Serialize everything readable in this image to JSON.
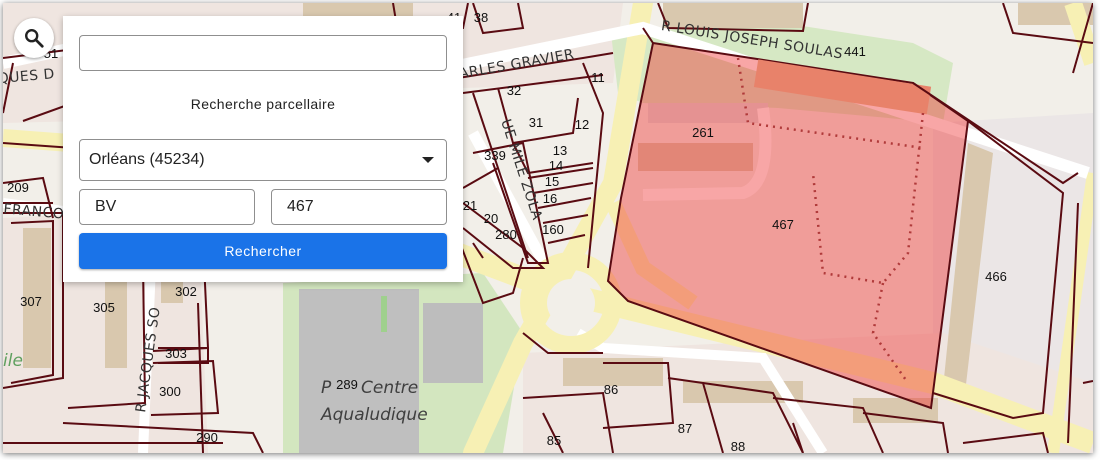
{
  "search_panel": {
    "free_search_value": "",
    "title": "Recherche parcellaire",
    "commune_value": "Orléans (45234)",
    "section_value": "BV",
    "numero_value": "467",
    "submit_label": "Rechercher",
    "toggle_icon": "search-icon",
    "dropdown_icon": "caret-down-icon"
  },
  "map": {
    "parcel_numbers": [
      "38",
      "41",
      "51",
      "11",
      "32",
      "31",
      "12",
      "339",
      "13",
      "14",
      "15",
      "16",
      "21",
      "20",
      "280",
      "160",
      "209",
      "307",
      "305",
      "302",
      "303",
      "300",
      "290",
      "261",
      "441",
      "467",
      "466",
      "289",
      "86",
      "87",
      "88",
      "85"
    ],
    "street_labels": [
      "QUES D",
      "ARLES GRAVIER",
      "R LOUIS JOSEPH SOULAS",
      "FRANCO",
      "R JACQUES SO",
      "UE MILE ZOLA"
    ],
    "poi_labels": [
      "Centre",
      "Aqualudique"
    ],
    "partial_labels": [
      "ile",
      "P"
    ],
    "highlight_color": "#ee2b2b",
    "parcel_line_color": "#5a0b12"
  }
}
